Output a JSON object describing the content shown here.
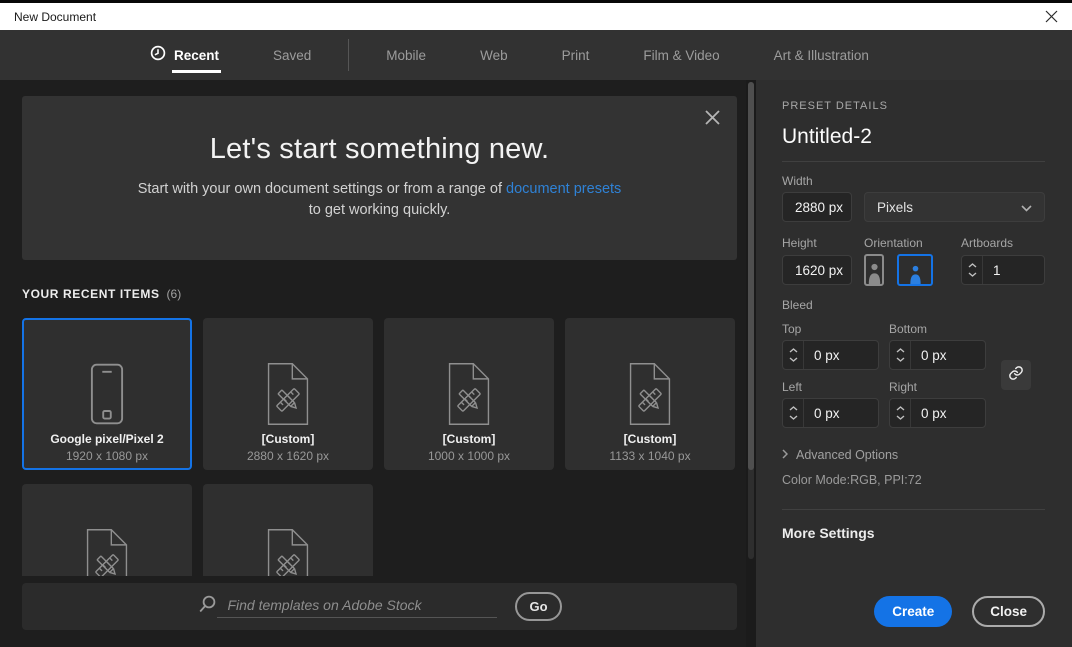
{
  "dialog": {
    "title": "New Document"
  },
  "tabs": [
    {
      "label": "Recent",
      "active": true
    },
    {
      "label": "Saved"
    },
    {
      "label": "Mobile"
    },
    {
      "label": "Web"
    },
    {
      "label": "Print"
    },
    {
      "label": "Film & Video"
    },
    {
      "label": "Art & Illustration"
    }
  ],
  "hero": {
    "title": "Let's start something new.",
    "subtitle_before": "Start with your own document settings or from a range of ",
    "link_text": "document presets",
    "subtitle_after": "to get working quickly."
  },
  "recent": {
    "heading": "YOUR RECENT ITEMS",
    "count_label": "(6)",
    "items": [
      {
        "name": "Google pixel/Pixel 2",
        "size": "1920 x 1080 px",
        "icon": "phone",
        "selected": true
      },
      {
        "name": "[Custom]",
        "size": "2880 x 1620 px",
        "icon": "document"
      },
      {
        "name": "[Custom]",
        "size": "1000 x 1000 px",
        "icon": "document"
      },
      {
        "name": "[Custom]",
        "size": "1133 x 1040 px",
        "icon": "document"
      },
      {
        "icon": "document"
      },
      {
        "icon": "document"
      }
    ]
  },
  "search": {
    "placeholder": "Find templates on Adobe Stock",
    "go_label": "Go"
  },
  "preset": {
    "heading": "PRESET DETAILS",
    "name": "Untitled-2",
    "width_label": "Width",
    "width_value": "2880 px",
    "units_value": "Pixels",
    "height_label": "Height",
    "height_value": "1620 px",
    "orientation_label": "Orientation",
    "artboards_label": "Artboards",
    "artboards_value": "1",
    "bleed_label": "Bleed",
    "bleed": {
      "top_label": "Top",
      "top_value": "0 px",
      "bottom_label": "Bottom",
      "bottom_value": "0 px",
      "left_label": "Left",
      "left_value": "0 px",
      "right_label": "Right",
      "right_value": "0 px"
    },
    "advanced_label": "Advanced Options",
    "color_mode": "Color Mode:RGB, PPI:72",
    "more_settings_label": "More Settings",
    "create_label": "Create",
    "close_label": "Close"
  },
  "colors": {
    "accent_blue": "#1473e6",
    "link_blue": "#2f82d6",
    "titlebar_bg": "#ffffff"
  },
  "icons": [
    "clock-icon",
    "close-icon",
    "phone-icon",
    "document-preset-icon",
    "search-icon",
    "chevron-down-icon",
    "chevron-up-icon",
    "chevron-right-icon",
    "link-icon",
    "portrait-orientation-icon",
    "landscape-orientation-icon"
  ]
}
